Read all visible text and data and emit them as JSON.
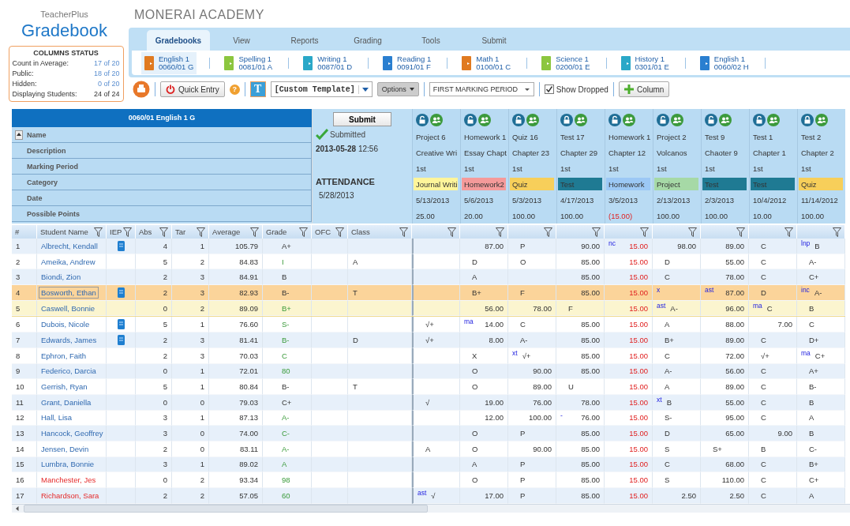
{
  "app": {
    "vendor": "TeacherPlus",
    "title": "Gradebook"
  },
  "school": "MONERAI ACADEMY",
  "columns_status": {
    "title": "COLUMNS STATUS",
    "items": [
      {
        "label": "Count in Average:",
        "value": "17 of 20",
        "link": true
      },
      {
        "label": "Public:",
        "value": "18 of 20",
        "link": true
      },
      {
        "label": "Hidden:",
        "value": "0 of 20",
        "link": true
      },
      {
        "label": "Displaying Students:",
        "value": "24 of 24",
        "link": false
      }
    ]
  },
  "tabs": [
    {
      "label": "Gradebooks",
      "selected": true
    },
    {
      "label": "View",
      "selected": false
    },
    {
      "label": "Reports",
      "selected": false
    },
    {
      "label": "Grading",
      "selected": false
    },
    {
      "label": "Tools",
      "selected": false
    },
    {
      "label": "Submit",
      "selected": false
    }
  ],
  "courses": [
    {
      "name": "English 1",
      "section": "0060/01 G",
      "color": "#e07a20",
      "selected": true
    },
    {
      "name": "Spelling 1",
      "section": "0081/01 A",
      "color": "#8cc63f",
      "selected": false
    },
    {
      "name": "Writing 1",
      "section": "0087/01 D",
      "color": "#2aa8c8",
      "selected": false
    },
    {
      "name": "Reading 1",
      "section": "0091/01 F",
      "color": "#2a7fd0",
      "selected": false
    },
    {
      "name": "Math 1",
      "section": "0100/01 C",
      "color": "#e07a20",
      "selected": false
    },
    {
      "name": "Science 1",
      "section": "0200/01 E",
      "color": "#8cc63f",
      "selected": false
    },
    {
      "name": "History 1",
      "section": "0301/01 E",
      "color": "#2aa8c8",
      "selected": false
    },
    {
      "name": "English 1",
      "section": "0060/02 H",
      "color": "#2a7fd0",
      "selected": false
    }
  ],
  "toolbar": {
    "quick_entry": "Quick Entry",
    "help": "?",
    "template_letter": "T",
    "template": "[Custom Template]",
    "options": "Options",
    "marking_period": "FIRST MARKING PERIOD",
    "show_dropped": {
      "label": "Show Dropped",
      "checked": true
    },
    "add_column": "Column"
  },
  "gradebook": {
    "title": "0060/01 English 1 G",
    "row_labels": [
      "Name",
      "Description",
      "Marking Period",
      "Category",
      "Date",
      "Possible Points"
    ],
    "submit": "Submit",
    "status": "Submitted",
    "submitted_date": "2013-05-28",
    "submitted_time": "12:56",
    "attendance_title": "ATTENDANCE",
    "attendance_date": "5/28/2013"
  },
  "assignments": [
    {
      "name": "Project 6",
      "description": "Creative Wri",
      "period": "1st",
      "category": "Journal Writi",
      "color": "#fff59a",
      "date": "5/13/2013",
      "points": "25.00",
      "locked": false,
      "extra_credit": false
    },
    {
      "name": "Homework 1",
      "description": "Essay Chapt",
      "period": "1st",
      "category": "Homework2",
      "color": "#f59a9a",
      "date": "5/6/2013",
      "points": "20.00",
      "locked": false,
      "extra_credit": false
    },
    {
      "name": "Quiz 16",
      "description": "Chapter 23",
      "period": "1st",
      "category": "Quiz",
      "color": "#f7cf5a",
      "date": "5/3/2013",
      "points": "100.00",
      "locked": false,
      "extra_credit": false
    },
    {
      "name": "Test 17",
      "description": "Chapter 29",
      "period": "1st",
      "category": "Test",
      "color": "#1f7a93",
      "date": "4/17/2013",
      "points": "100.00",
      "locked": true,
      "extra_credit": false
    },
    {
      "name": "Homework 1",
      "description": "Chapter 12",
      "period": "1st",
      "category": "Homework",
      "color": "#9cc8f5",
      "date": "3/5/2013",
      "points": "(15.00)",
      "locked": false,
      "extra_credit": true
    },
    {
      "name": "Project 2",
      "description": "Volcanos",
      "period": "1st",
      "category": "Project",
      "color": "#a6d9a6",
      "date": "2/13/2013",
      "points": "100.00",
      "locked": false,
      "extra_credit": false
    },
    {
      "name": "Test 9",
      "description": "Chaoter 9",
      "period": "1st",
      "category": "Test",
      "color": "#1f7a93",
      "date": "2/3/2013",
      "points": "100.00",
      "locked": false,
      "extra_credit": false
    },
    {
      "name": "Test 1",
      "description": "Chapter 1",
      "period": "1st",
      "category": "Test",
      "color": "#1f7a93",
      "date": "10/4/2012",
      "points": "10.00",
      "locked": false,
      "extra_credit": false
    },
    {
      "name": "Test 2",
      "description": "Chapter 2",
      "period": "1st",
      "category": "Quiz",
      "color": "#f7cf5a",
      "date": "11/14/2012",
      "points": "100.00",
      "locked": true,
      "extra_credit": false
    }
  ],
  "columns": [
    "#",
    "Student Name",
    "IEP",
    "Abs",
    "Tar",
    "Average",
    "Grade",
    "OFC",
    "Class"
  ],
  "students": [
    {
      "num": "1",
      "name": "Albrecht, Kendall",
      "iep": true,
      "abs": "4",
      "tar": "1",
      "average": "105.79",
      "grade": {
        "value": "A+",
        "override": false
      },
      "selected": false,
      "highlighted": false,
      "alert": false,
      "scores": [
        {
          "kind": "empty"
        },
        {
          "kind": "pts",
          "value": "87.00"
        },
        {
          "kind": "mark",
          "value": "P"
        },
        {
          "kind": "pts",
          "value": "90.00"
        },
        {
          "kind": "pts",
          "flag": "nc",
          "value": "15.00"
        },
        {
          "kind": "pts",
          "value": "98.00"
        },
        {
          "kind": "pts",
          "value": "89.00"
        },
        {
          "kind": "mark",
          "value": "C"
        },
        {
          "kind": "mark",
          "flag": "lnp",
          "value": "B"
        }
      ]
    },
    {
      "num": "2",
      "name": "Ameika, Andrew",
      "iep": false,
      "abs": "5",
      "tar": "2",
      "average": "84.83",
      "grade": {
        "value": "I",
        "override": true
      },
      "class": "A",
      "selected": false,
      "highlighted": false,
      "alert": false,
      "scores": [
        {
          "kind": "empty"
        },
        {
          "kind": "mark",
          "value": "D"
        },
        {
          "kind": "mark",
          "value": "O"
        },
        {
          "kind": "pts",
          "value": "85.00"
        },
        {
          "kind": "pts",
          "value": "15.00"
        },
        {
          "kind": "mark",
          "value": "D"
        },
        {
          "kind": "pts",
          "value": "55.00"
        },
        {
          "kind": "mark",
          "value": "C"
        },
        {
          "kind": "mark",
          "value": "A-"
        }
      ]
    },
    {
      "num": "3",
      "name": "Biondi, Zion",
      "iep": false,
      "abs": "2",
      "tar": "3",
      "average": "84.91",
      "grade": {
        "value": "B",
        "override": false
      },
      "selected": false,
      "highlighted": false,
      "alert": false,
      "scores": [
        {
          "kind": "empty"
        },
        {
          "kind": "mark",
          "value": "A"
        },
        {
          "kind": "empty"
        },
        {
          "kind": "pts",
          "value": "85.00"
        },
        {
          "kind": "pts",
          "value": "15.00"
        },
        {
          "kind": "mark",
          "value": "C"
        },
        {
          "kind": "pts",
          "value": "78.00"
        },
        {
          "kind": "mark",
          "value": "C"
        },
        {
          "kind": "mark",
          "value": "C+"
        }
      ]
    },
    {
      "num": "4",
      "name": "Bosworth, Ethan",
      "iep": true,
      "abs": "2",
      "tar": "3",
      "average": "82.93",
      "grade": {
        "value": "B-",
        "override": false
      },
      "class": "T",
      "selected": true,
      "highlighted": false,
      "alert": false,
      "scores": [
        {
          "kind": "empty"
        },
        {
          "kind": "mark",
          "value": "B+"
        },
        {
          "kind": "mark",
          "value": "F"
        },
        {
          "kind": "pts",
          "value": "85.00"
        },
        {
          "kind": "pts",
          "value": "15.00"
        },
        {
          "kind": "flag",
          "flag": "x"
        },
        {
          "kind": "pts",
          "flag": "ast",
          "value": "87.00"
        },
        {
          "kind": "mark",
          "value": "D"
        },
        {
          "kind": "mark",
          "flag": "inc",
          "value": "A-"
        }
      ]
    },
    {
      "num": "5",
      "name": "Caswell, Bonnie",
      "iep": false,
      "abs": "0",
      "tar": "2",
      "average": "89.09",
      "grade": {
        "value": "B+",
        "override": true
      },
      "selected": false,
      "highlighted": true,
      "alert": false,
      "scores": [
        {
          "kind": "empty"
        },
        {
          "kind": "pts",
          "value": "56.00"
        },
        {
          "kind": "pts",
          "value": "78.00"
        },
        {
          "kind": "mark",
          "value": "F"
        },
        {
          "kind": "pts",
          "value": "15.00"
        },
        {
          "kind": "mark",
          "flag": "ast",
          "value": "A-"
        },
        {
          "kind": "pts",
          "value": "96.00"
        },
        {
          "kind": "mark",
          "flag": "ma",
          "value": "C"
        },
        {
          "kind": "mark",
          "value": "B"
        }
      ]
    },
    {
      "num": "6",
      "name": "Dubois, Nicole",
      "iep": true,
      "abs": "5",
      "tar": "1",
      "average": "76.60",
      "grade": {
        "value": "S-",
        "override": true
      },
      "selected": false,
      "highlighted": false,
      "alert": false,
      "scores": [
        {
          "kind": "mark",
          "value": "√+"
        },
        {
          "kind": "pts",
          "flag": "ma",
          "value": "14.00"
        },
        {
          "kind": "mark",
          "value": "C"
        },
        {
          "kind": "pts",
          "value": "85.00"
        },
        {
          "kind": "pts",
          "value": "15.00"
        },
        {
          "kind": "mark",
          "value": "A"
        },
        {
          "kind": "pts",
          "value": "88.00"
        },
        {
          "kind": "pts",
          "value": "7.00"
        },
        {
          "kind": "mark",
          "value": "C"
        }
      ]
    },
    {
      "num": "7",
      "name": "Edwards, James",
      "iep": true,
      "abs": "2",
      "tar": "3",
      "average": "81.41",
      "grade": {
        "value": "B-",
        "override": true
      },
      "class": "D",
      "selected": false,
      "highlighted": false,
      "alert": false,
      "scores": [
        {
          "kind": "mark",
          "value": "√+"
        },
        {
          "kind": "pts",
          "value": "8.00"
        },
        {
          "kind": "mark",
          "value": "A-"
        },
        {
          "kind": "pts",
          "value": "85.00"
        },
        {
          "kind": "pts",
          "value": "15.00"
        },
        {
          "kind": "mark",
          "value": "B+"
        },
        {
          "kind": "pts",
          "value": "89.00"
        },
        {
          "kind": "mark",
          "value": "C"
        },
        {
          "kind": "mark",
          "value": "D+"
        }
      ]
    },
    {
      "num": "8",
      "name": "Ephron, Faith",
      "iep": false,
      "abs": "2",
      "tar": "3",
      "average": "70.03",
      "grade": {
        "value": "C",
        "override": true
      },
      "selected": false,
      "highlighted": false,
      "alert": false,
      "scores": [
        {
          "kind": "empty"
        },
        {
          "kind": "mark",
          "value": "X"
        },
        {
          "kind": "mark",
          "flag": "xt",
          "value": "√+"
        },
        {
          "kind": "pts",
          "value": "85.00"
        },
        {
          "kind": "pts",
          "value": "15.00"
        },
        {
          "kind": "mark",
          "value": "C"
        },
        {
          "kind": "pts",
          "value": "72.00"
        },
        {
          "kind": "mark",
          "value": "√+"
        },
        {
          "kind": "mark",
          "flag": "ma",
          "value": "C+"
        }
      ]
    },
    {
      "num": "9",
      "name": "Federico, Darcia",
      "iep": false,
      "abs": "0",
      "tar": "1",
      "average": "72.01",
      "grade": {
        "value": "80",
        "override": true
      },
      "selected": false,
      "highlighted": false,
      "alert": false,
      "scores": [
        {
          "kind": "empty"
        },
        {
          "kind": "mark",
          "value": "O"
        },
        {
          "kind": "pts",
          "value": "90.00"
        },
        {
          "kind": "pts",
          "value": "85.00"
        },
        {
          "kind": "pts",
          "value": "15.00"
        },
        {
          "kind": "mark",
          "value": "A-"
        },
        {
          "kind": "pts",
          "value": "56.00"
        },
        {
          "kind": "mark",
          "value": "C"
        },
        {
          "kind": "mark",
          "value": "A+"
        }
      ]
    },
    {
      "num": "10",
      "name": "Gerrish, Ryan",
      "iep": false,
      "abs": "5",
      "tar": "1",
      "average": "80.84",
      "grade": {
        "value": "B-",
        "override": false
      },
      "class": "T",
      "selected": false,
      "highlighted": false,
      "alert": false,
      "scores": [
        {
          "kind": "empty"
        },
        {
          "kind": "mark",
          "value": "O"
        },
        {
          "kind": "pts",
          "value": "89.00"
        },
        {
          "kind": "mark",
          "value": "U"
        },
        {
          "kind": "pts",
          "value": "15.00"
        },
        {
          "kind": "mark",
          "value": "A"
        },
        {
          "kind": "pts",
          "value": "89.00"
        },
        {
          "kind": "mark",
          "value": "C"
        },
        {
          "kind": "mark",
          "value": "B-"
        }
      ]
    },
    {
      "num": "11",
      "name": "Grant, Daniella",
      "iep": false,
      "abs": "0",
      "tar": "0",
      "average": "79.03",
      "grade": {
        "value": "C+",
        "override": false
      },
      "selected": false,
      "highlighted": false,
      "alert": false,
      "scores": [
        {
          "kind": "mark",
          "value": "√"
        },
        {
          "kind": "pts",
          "value": "19.00"
        },
        {
          "kind": "pts",
          "value": "76.00"
        },
        {
          "kind": "pts",
          "value": "78.00"
        },
        {
          "kind": "pts",
          "value": "15.00"
        },
        {
          "kind": "mark",
          "flag": "xt",
          "value": "B"
        },
        {
          "kind": "pts",
          "value": "55.00"
        },
        {
          "kind": "mark",
          "value": "C"
        },
        {
          "kind": "mark",
          "value": "B"
        }
      ]
    },
    {
      "num": "12",
      "name": "Hall, Lisa",
      "iep": false,
      "abs": "3",
      "tar": "1",
      "average": "87.13",
      "grade": {
        "value": "A-",
        "override": true
      },
      "selected": false,
      "highlighted": false,
      "alert": false,
      "scores": [
        {
          "kind": "empty"
        },
        {
          "kind": "pts",
          "value": "12.00"
        },
        {
          "kind": "pts",
          "value": "100.00"
        },
        {
          "kind": "pts",
          "flag": "-",
          "value": "76.00"
        },
        {
          "kind": "pts",
          "value": "15.00"
        },
        {
          "kind": "mark",
          "value": "S-"
        },
        {
          "kind": "pts",
          "value": "95.00"
        },
        {
          "kind": "mark",
          "value": "C"
        },
        {
          "kind": "mark",
          "value": "A"
        }
      ]
    },
    {
      "num": "13",
      "name": "Hancock, Geoffrey",
      "iep": false,
      "abs": "3",
      "tar": "0",
      "average": "74.00",
      "grade": {
        "value": "C-",
        "override": true
      },
      "selected": false,
      "highlighted": false,
      "alert": false,
      "scores": [
        {
          "kind": "empty"
        },
        {
          "kind": "mark",
          "value": "O"
        },
        {
          "kind": "mark",
          "value": "P"
        },
        {
          "kind": "pts",
          "value": "85.00"
        },
        {
          "kind": "pts",
          "value": "15.00"
        },
        {
          "kind": "mark",
          "value": "D"
        },
        {
          "kind": "pts",
          "value": "65.00"
        },
        {
          "kind": "pts",
          "value": "9.00"
        },
        {
          "kind": "mark",
          "value": "B"
        }
      ]
    },
    {
      "num": "14",
      "name": "Jensen, Devin",
      "iep": false,
      "abs": "2",
      "tar": "0",
      "average": "83.11",
      "grade": {
        "value": "A-",
        "override": true
      },
      "selected": false,
      "highlighted": false,
      "alert": false,
      "scores": [
        {
          "kind": "mark",
          "value": "A"
        },
        {
          "kind": "mark",
          "value": "O"
        },
        {
          "kind": "pts",
          "value": "90.00"
        },
        {
          "kind": "pts",
          "value": "85.00"
        },
        {
          "kind": "pts",
          "value": "15.00"
        },
        {
          "kind": "mark",
          "value": "S"
        },
        {
          "kind": "mark",
          "value": "S+"
        },
        {
          "kind": "mark",
          "value": "B"
        },
        {
          "kind": "mark",
          "value": "C-"
        }
      ]
    },
    {
      "num": "15",
      "name": "Lumbra, Bonnie",
      "iep": false,
      "abs": "3",
      "tar": "1",
      "average": "89.02",
      "grade": {
        "value": "A",
        "override": true
      },
      "selected": false,
      "highlighted": false,
      "alert": false,
      "scores": [
        {
          "kind": "empty"
        },
        {
          "kind": "mark",
          "value": "A"
        },
        {
          "kind": "mark",
          "value": "P"
        },
        {
          "kind": "pts",
          "value": "85.00"
        },
        {
          "kind": "pts",
          "value": "15.00"
        },
        {
          "kind": "mark",
          "value": "C"
        },
        {
          "kind": "pts",
          "value": "68.00"
        },
        {
          "kind": "mark",
          "value": "C"
        },
        {
          "kind": "mark",
          "value": "B+"
        }
      ]
    },
    {
      "num": "16",
      "name": "Manchester, Jes",
      "iep": false,
      "abs": "0",
      "tar": "2",
      "average": "93.34",
      "grade": {
        "value": "98",
        "override": true
      },
      "selected": false,
      "highlighted": false,
      "alert": true,
      "scores": [
        {
          "kind": "empty"
        },
        {
          "kind": "mark",
          "value": "O"
        },
        {
          "kind": "mark",
          "value": "P"
        },
        {
          "kind": "pts",
          "value": "85.00"
        },
        {
          "kind": "pts",
          "value": "15.00"
        },
        {
          "kind": "mark",
          "value": "S"
        },
        {
          "kind": "pts",
          "value": "110.00"
        },
        {
          "kind": "mark",
          "value": "C"
        },
        {
          "kind": "mark",
          "value": "C+"
        }
      ]
    },
    {
      "num": "17",
      "name": "Richardson, Sara",
      "iep": false,
      "abs": "2",
      "tar": "2",
      "average": "57.05",
      "grade": {
        "value": "60",
        "override": true
      },
      "selected": false,
      "highlighted": false,
      "alert": true,
      "scores": [
        {
          "kind": "mark",
          "flag": "ast",
          "value": "√"
        },
        {
          "kind": "pts",
          "value": "17.00"
        },
        {
          "kind": "mark",
          "value": "P"
        },
        {
          "kind": "pts",
          "value": "85.00"
        },
        {
          "kind": "pts",
          "value": "15.00"
        },
        {
          "kind": "pts",
          "value": "2.50"
        },
        {
          "kind": "pts",
          "value": "2.50"
        },
        {
          "kind": "mark",
          "value": "C"
        },
        {
          "kind": "mark",
          "value": "A"
        }
      ]
    }
  ]
}
